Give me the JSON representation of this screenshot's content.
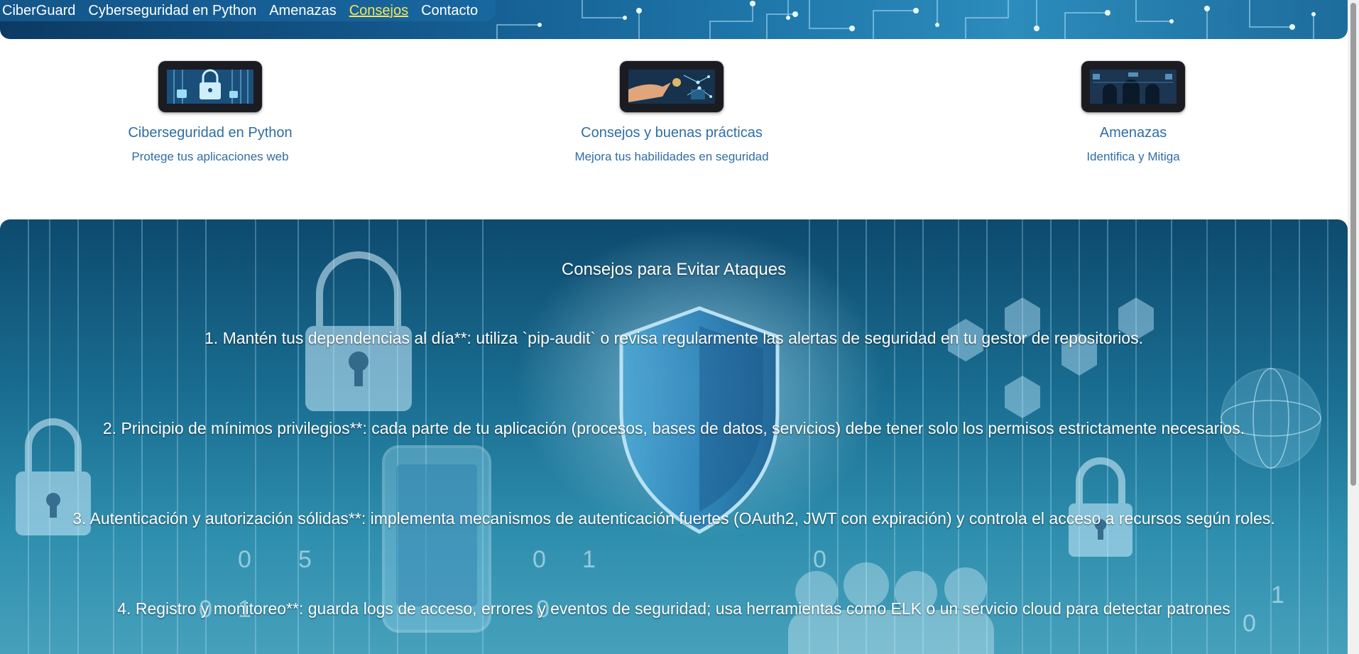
{
  "nav": {
    "items": [
      {
        "label": "CiberGuard",
        "active": false
      },
      {
        "label": "Cyberseguridad en Python",
        "active": false
      },
      {
        "label": "Amenazas",
        "active": false
      },
      {
        "label": "Consejos",
        "active": true
      },
      {
        "label": "Contacto",
        "active": false
      }
    ]
  },
  "cards": [
    {
      "title": "Ciberseguridad en Python",
      "subtitle": "Protege tus aplicaciones web",
      "image_icon": "padlock-image-icon"
    },
    {
      "title": "Consejos y buenas prácticas",
      "subtitle": "Mejora tus habilidades en seguridad",
      "image_icon": "hand-network-image-icon"
    },
    {
      "title": "Amenazas",
      "subtitle": "Identifica y Mitiga",
      "image_icon": "hooded-hackers-image-icon"
    }
  ],
  "tips": {
    "heading": "Consejos para Evitar Ataques",
    "items": [
      "1. Mantén tus dependencias al día**: utiliza `pip-audit` o revisa regularmente las alertas de seguridad en tu gestor de repositorios.",
      "2. Principio de mínimos privilegios**: cada parte de tu aplicación (procesos, bases de datos, servicios) debe tener solo los permisos estrictamente necesarios.",
      "3. Autenticación y autorización sólidas**: implementa mecanismos de autenticación fuertes (OAuth2, JWT con expiración) y controla el acceso a recursos según roles.",
      "4. Registro y monitoreo**: guarda logs de acceso, errores y eventos de seguridad; usa herramientas como ELK o un servicio cloud para detectar patrones"
    ]
  },
  "colors": {
    "nav_active": "#f3e65b",
    "card_text": "#2f6da5",
    "hero_text": "#ffffff"
  }
}
